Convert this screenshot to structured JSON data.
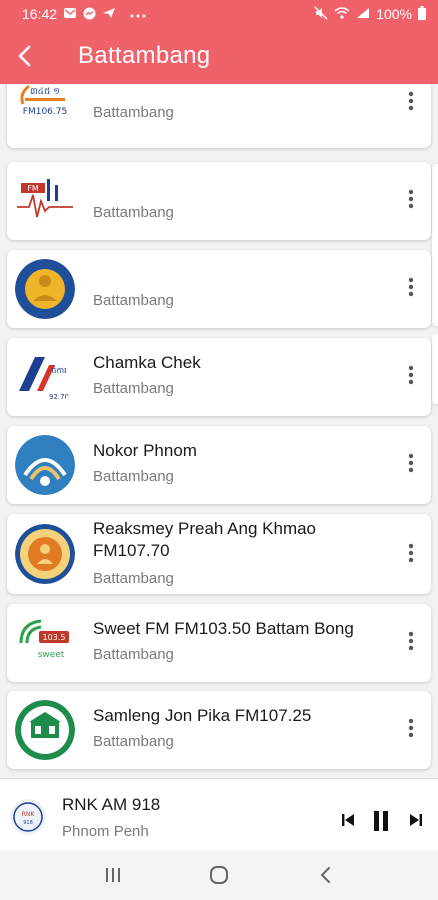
{
  "status_bar": {
    "time": "16:42",
    "battery": "100%",
    "icons": [
      "mail-icon",
      "messenger-icon",
      "telegram-icon",
      "more-dots-icon",
      "mute-icon",
      "wifi-icon",
      "signal-icon",
      "battery-icon"
    ]
  },
  "app_bar": {
    "title": "Battambang",
    "back_icon": "arrow-back-icon"
  },
  "stations": [
    {
      "name": "",
      "city": "Battambang",
      "logo": "radio-logo-fm"
    },
    {
      "name": "",
      "city": "Battambang",
      "logo": "radio-logo-signal"
    },
    {
      "name": "",
      "city": "Battambang",
      "logo": "radio-logo-buddha"
    },
    {
      "name": "Chamka Chek",
      "city": "Battambang",
      "logo": "radio-logo-chamka"
    },
    {
      "name": "Nokor Phnom",
      "city": "Battambang",
      "logo": "radio-logo-nokor"
    },
    {
      "name": "Reaksmey Preah Ang Khmao FM107.70",
      "city": "Battambang",
      "logo": "radio-logo-reaksmey"
    },
    {
      "name": "Sweet FM FM103.50 Battam Bong",
      "city": "Battambang",
      "logo": "radio-logo-sweet"
    },
    {
      "name": "Samleng Jon Pika FM107.25",
      "city": "Battambang",
      "logo": "radio-logo-samleng"
    }
  ],
  "player": {
    "name": "RNK AM 918",
    "city": "Phnom Penh",
    "controls": [
      "previous-icon",
      "pause-icon",
      "next-icon"
    ]
  },
  "nav": [
    "recent-apps-icon",
    "home-icon",
    "back-icon"
  ],
  "colors": {
    "accent": "#f0626a",
    "card": "#ffffff",
    "background": "#f2f2f2"
  }
}
